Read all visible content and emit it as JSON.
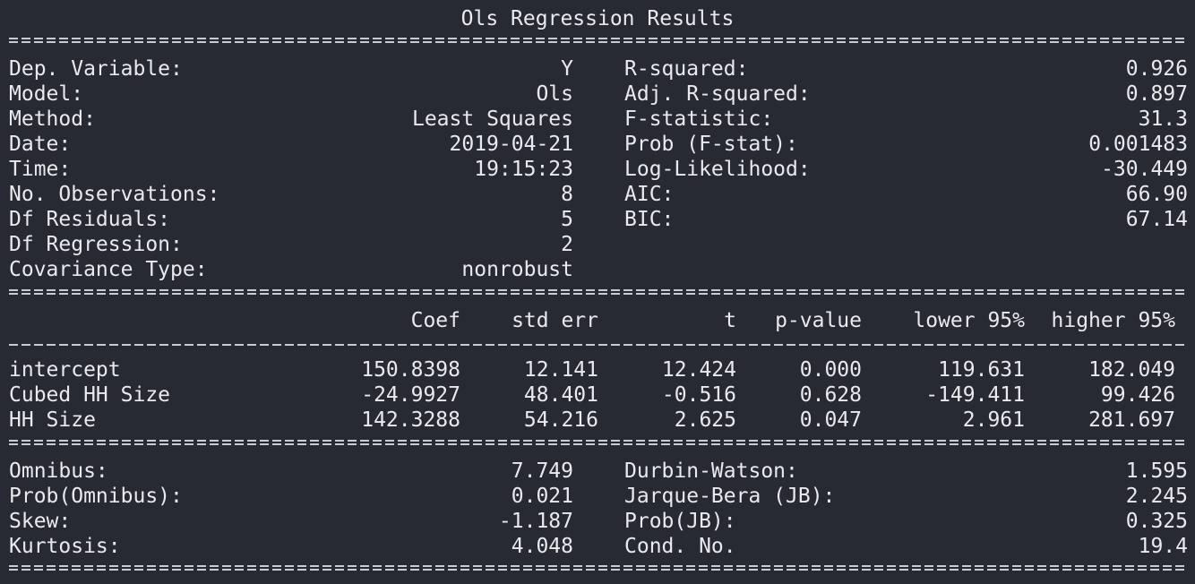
{
  "title": "Ols Regression Results",
  "info_left": [
    {
      "label": "Dep. Variable:",
      "value": "Y"
    },
    {
      "label": "Model:",
      "value": "Ols"
    },
    {
      "label": "Method:",
      "value": "Least Squares"
    },
    {
      "label": "Date:",
      "value": "2019-04-21"
    },
    {
      "label": "Time:",
      "value": "19:15:23"
    },
    {
      "label": "No. Observations:",
      "value": "8"
    },
    {
      "label": "Df Residuals:",
      "value": "5"
    },
    {
      "label": "Df Regression:",
      "value": "2"
    },
    {
      "label": "Covariance Type:",
      "value": "nonrobust"
    }
  ],
  "info_right": [
    {
      "label": "R-squared:",
      "value": "0.926"
    },
    {
      "label": "Adj. R-squared:",
      "value": "0.897"
    },
    {
      "label": "F-statistic:",
      "value": "31.3"
    },
    {
      "label": "Prob (F-stat):",
      "value": "0.001483"
    },
    {
      "label": "Log-Likelihood:",
      "value": "-30.449"
    },
    {
      "label": "AIC:",
      "value": "66.90"
    },
    {
      "label": "BIC:",
      "value": "67.14"
    }
  ],
  "coef_header": [
    "Coef",
    "std err",
    "t",
    "p-value",
    "lower 95%",
    "higher 95%"
  ],
  "coef_rows": [
    {
      "name": "intercept",
      "cells": [
        "150.8398",
        "12.141",
        "12.424",
        "0.000",
        "119.631",
        "182.049"
      ]
    },
    {
      "name": "Cubed HH Size",
      "cells": [
        "-24.9927",
        "48.401",
        "-0.516",
        "0.628",
        "-149.411",
        "99.426"
      ]
    },
    {
      "name": "HH Size",
      "cells": [
        "142.3288",
        "54.216",
        "2.625",
        "0.047",
        "2.961",
        "281.697"
      ]
    }
  ],
  "diag_left": [
    {
      "label": "Omnibus:",
      "value": "7.749"
    },
    {
      "label": "Prob(Omnibus):",
      "value": "0.021"
    },
    {
      "label": "Skew:",
      "value": "-1.187"
    },
    {
      "label": "Kurtosis:",
      "value": "4.048"
    }
  ],
  "diag_right": [
    {
      "label": "Durbin-Watson:",
      "value": "1.595"
    },
    {
      "label": "Jarque-Bera (JB):",
      "value": "2.245"
    },
    {
      "label": "Prob(JB):",
      "value": "0.325"
    },
    {
      "label": "Cond. No.",
      "value": "19.4"
    }
  ]
}
